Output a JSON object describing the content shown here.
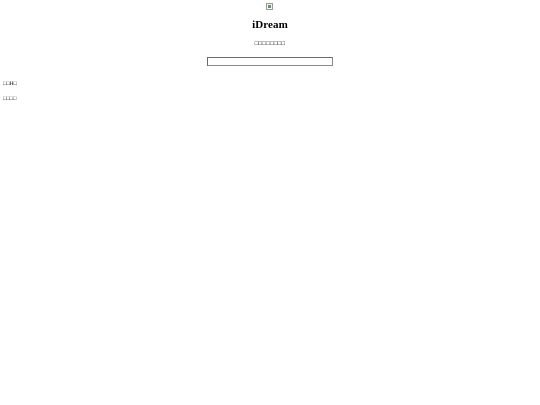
{
  "header": {
    "logo_icon": "broken-image-icon",
    "title": "iDream",
    "subtitle": "□□□□□□□□"
  },
  "search": {
    "value": "",
    "placeholder": ""
  },
  "links": [
    {
      "label": "□□H□"
    },
    {
      "label": "□□□□"
    }
  ]
}
